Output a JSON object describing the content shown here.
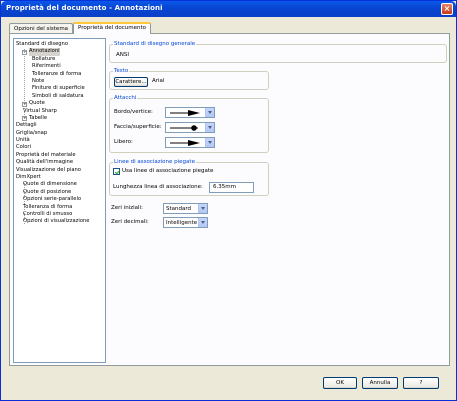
{
  "window": {
    "title": "Proprietà del documento - Annotazioni",
    "close_glyph": "×"
  },
  "tabs": [
    {
      "label": "Opzioni del sistema"
    },
    {
      "label": "Proprietà del documento"
    }
  ],
  "tree": {
    "items": [
      {
        "label": "Standard di disegno",
        "level": 0
      },
      {
        "label": "Annotazioni",
        "level": 1,
        "expander": "−",
        "selected": true
      },
      {
        "label": "Bollature",
        "level": 2
      },
      {
        "label": "Riferimenti",
        "level": 2
      },
      {
        "label": "Tolleranze di forma",
        "level": 2
      },
      {
        "label": "Note",
        "level": 2
      },
      {
        "label": "Finiture di superficie",
        "level": 2
      },
      {
        "label": "Simboli di saldatura",
        "level": 2
      },
      {
        "label": "Quote",
        "level": 1,
        "expander": "+"
      },
      {
        "label": "Virtual Sharp",
        "level": 1
      },
      {
        "label": "Tabelle",
        "level": 1,
        "expander": "+"
      },
      {
        "label": "Dettagli",
        "level": 0
      },
      {
        "label": "Griglia/snap",
        "level": 0
      },
      {
        "label": "Unità",
        "level": 0
      },
      {
        "label": "Colori",
        "level": 0
      },
      {
        "label": "Proprietà del materiale",
        "level": 0
      },
      {
        "label": "Qualità dell'immagine",
        "level": 0
      },
      {
        "label": "Visualizzazione del piano",
        "level": 0
      },
      {
        "label": "DimXpert",
        "level": 0
      },
      {
        "label": "Quote di dimensione",
        "level": 1
      },
      {
        "label": "Quote di posizione",
        "level": 1
      },
      {
        "label": "Opzioni serie-parallelo",
        "level": 1
      },
      {
        "label": "Tolleranza di forma",
        "level": 1
      },
      {
        "label": "Controlli di smusso",
        "level": 1
      },
      {
        "label": "Opzioni di visualizzazione",
        "level": 1
      }
    ]
  },
  "standard": {
    "title": "Standard di disegno generale",
    "value": "ANSI"
  },
  "testo": {
    "title": "Testo",
    "font_button": "Carattere...",
    "font_name": "Arial"
  },
  "attacchi": {
    "title": "Attacchi",
    "rows": [
      {
        "label": "Bordo/vertice:",
        "arrow": "filled-arrow"
      },
      {
        "label": "Faccia/superficie:",
        "arrow": "dot-arrow"
      },
      {
        "label": "Libero:",
        "arrow": "filled-arrow"
      }
    ]
  },
  "bent_leaders": {
    "title": "Linee di associazione piegate",
    "checkbox_label": "Usa linee di associazione piegate",
    "checked": true,
    "length_label": "Lunghezza linea di associazione:",
    "length_value": "6.35mm"
  },
  "zeros": {
    "leading_label": "Zeri iniziali:",
    "leading_value": "Standard",
    "trailing_label": "Zeri decimali:",
    "trailing_value": "Intelligente"
  },
  "footer": {
    "ok": "OK",
    "cancel": "Annulla",
    "help": "?"
  },
  "colors": {
    "title_bar": "#0846d3",
    "group_title": "#0046d5",
    "window_bg": "#ece9d8"
  }
}
